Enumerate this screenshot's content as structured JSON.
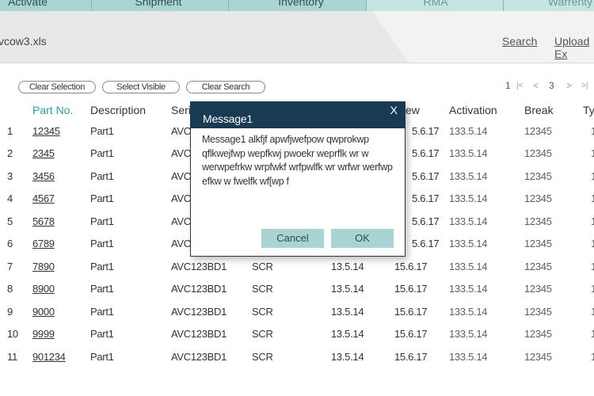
{
  "tabs": [
    "Activate",
    "Shipment",
    "Inventory",
    "RMA",
    "Warrenty"
  ],
  "file": {
    "name": "vcow3.xls",
    "search_link": "Search",
    "upload_link": "Upload Ex"
  },
  "toolbar": {
    "clear_selection": "Clear Selection",
    "select_visible": "Select Visible",
    "clear_search": "Clear Search"
  },
  "pager": {
    "current": "1",
    "first": "|<",
    "prev": "<",
    "page": "3",
    "next": ">",
    "last": ">|"
  },
  "table": {
    "headers": [
      "Part No.",
      "Description",
      "Seri",
      "ew",
      "Activation",
      "Break",
      "Ty"
    ],
    "rows": [
      {
        "num": "1",
        "part": "12345",
        "desc": "Part1",
        "serial": "AVC",
        "type": "",
        "d1": "",
        "d2": "5.6.17",
        "act": "133.5.14",
        "brk": "12345",
        "ty": "1"
      },
      {
        "num": "2",
        "part": "2345",
        "desc": "Part1",
        "serial": "AVC",
        "type": "",
        "d1": "",
        "d2": "5.6.17",
        "act": "133.5.14",
        "brk": "12345",
        "ty": "1"
      },
      {
        "num": "3",
        "part": "3456",
        "desc": "Part1",
        "serial": "AVC",
        "type": "",
        "d1": "",
        "d2": "5.6.17",
        "act": "133.5.14",
        "brk": "12345",
        "ty": "1"
      },
      {
        "num": "4",
        "part": "4567",
        "desc": "Part1",
        "serial": "AVC",
        "type": "",
        "d1": "",
        "d2": "5.6.17",
        "act": "133.5.14",
        "brk": "12345",
        "ty": "1"
      },
      {
        "num": "5",
        "part": "5678",
        "desc": "Part1",
        "serial": "AVC",
        "type": "",
        "d1": "",
        "d2": "5.6.17",
        "act": "133.5.14",
        "brk": "12345",
        "ty": "1"
      },
      {
        "num": "6",
        "part": "6789",
        "desc": "Part1",
        "serial": "AVC",
        "type": "",
        "d1": "",
        "d2": "5.6.17",
        "act": "133.5.14",
        "brk": "12345",
        "ty": "1"
      },
      {
        "num": "7",
        "part": "7890",
        "desc": "Part1",
        "serial": "AVC123BD1",
        "type": "SCR",
        "d1": "13.5.14",
        "d2": "15.6.17",
        "act": "133.5.14",
        "brk": "12345",
        "ty": "1"
      },
      {
        "num": "8",
        "part": "8900",
        "desc": "Part1",
        "serial": "AVC123BD1",
        "type": "SCR",
        "d1": "13.5.14",
        "d2": "15.6.17",
        "act": "133.5.14",
        "brk": "12345",
        "ty": "1"
      },
      {
        "num": "9",
        "part": "9000",
        "desc": "Part1",
        "serial": "AVC123BD1",
        "type": "SCR",
        "d1": "13.5.14",
        "d2": "15.6.17",
        "act": "133.5.14",
        "brk": "12345",
        "ty": "1"
      },
      {
        "num": "10",
        "part": "9999",
        "desc": "Part1",
        "serial": "AVC123BD1",
        "type": "SCR",
        "d1": "13.5.14",
        "d2": "15.6.17",
        "act": "133.5.14",
        "brk": "12345",
        "ty": "1"
      },
      {
        "num": "11",
        "part": "901234",
        "desc": "Part1",
        "serial": "AVC123BD1",
        "type": "SCR",
        "d1": "13.5.14",
        "d2": "15.6.17",
        "act": "133.5.14",
        "brk": "12345",
        "ty": "1"
      }
    ]
  },
  "modal": {
    "title": "Message1",
    "close": "X",
    "body": "Message1 alkfjf apwfjwefpow qwprokwp qflkwejfwp wepfkwj pwoekr weprflk wr w werwpefrkw wrpfwkf wrfpwlfk wr wrfwr werfwp efkw w fwelfk wf[wp f",
    "cancel": "Cancel",
    "ok": "OK"
  },
  "colors": {
    "tab_bg": "#a9d6d4",
    "accent": "#2aa39a",
    "modal_header": "#183a52",
    "modal_button": "#a8d5d3"
  }
}
